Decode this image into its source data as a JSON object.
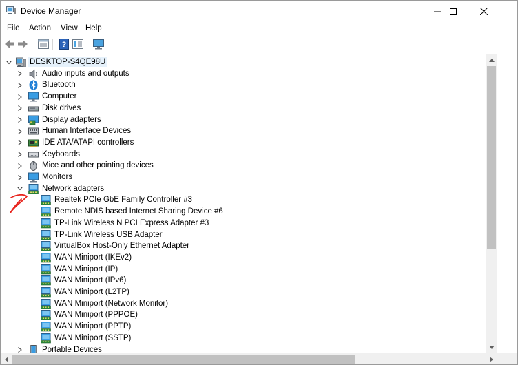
{
  "window": {
    "title": "Device Manager"
  },
  "menu": [
    "File",
    "Action",
    "View",
    "Help"
  ],
  "toolbar": {
    "buttons": [
      "back-icon",
      "forward-icon",
      "properties-icon",
      "help-icon",
      "details-icon",
      "monitor-icon"
    ]
  },
  "tree": {
    "root": "DESKTOP-S4QE98U",
    "categories": [
      {
        "label": "Audio inputs and outputs",
        "icon": "speaker-icon"
      },
      {
        "label": "Bluetooth",
        "icon": "bluetooth-icon"
      },
      {
        "label": "Computer",
        "icon": "computer-icon"
      },
      {
        "label": "Disk drives",
        "icon": "disk-drive-icon"
      },
      {
        "label": "Display adapters",
        "icon": "display-adapter-icon"
      },
      {
        "label": "Human Interface Devices",
        "icon": "hid-icon"
      },
      {
        "label": "IDE ATA/ATAPI controllers",
        "icon": "ide-controller-icon"
      },
      {
        "label": "Keyboards",
        "icon": "keyboard-icon"
      },
      {
        "label": "Mice and other pointing devices",
        "icon": "mouse-icon"
      },
      {
        "label": "Monitors",
        "icon": "monitor-icon"
      },
      {
        "label": "Network adapters",
        "icon": "network-adapter-icon",
        "expanded": true
      }
    ],
    "network_adapters": [
      "Realtek PCIe GbE Family Controller #3",
      "Remote NDIS based Internet Sharing Device #6",
      "TP-Link Wireless N PCI Express Adapter #3",
      "TP-Link Wireless USB Adapter",
      "VirtualBox Host-Only Ethernet Adapter",
      "WAN Miniport (IKEv2)",
      "WAN Miniport (IP)",
      "WAN Miniport (IPv6)",
      "WAN Miniport (L2TP)",
      "WAN Miniport (Network Monitor)",
      "WAN Miniport (PPPOE)",
      "WAN Miniport (PPTP)",
      "WAN Miniport (SSTP)"
    ],
    "after": [
      {
        "label": "Portable Devices",
        "icon": "portable-device-icon"
      }
    ]
  },
  "colors": {
    "selection": "#e5f1fb",
    "annotation": "#e8231c",
    "scroll_thumb": "#c1c1c1"
  }
}
